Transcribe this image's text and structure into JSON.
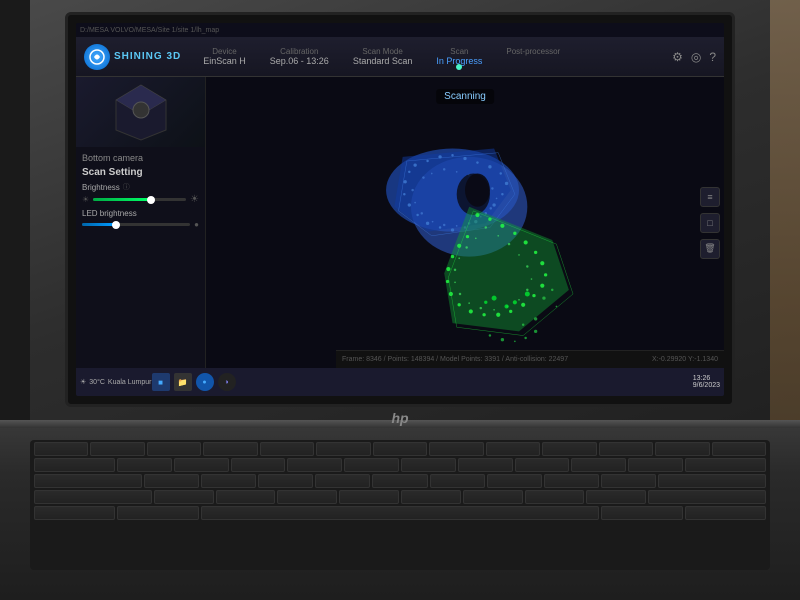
{
  "window": {
    "title": "D:/MESA VOLVO/MESA/Site 1/site 1/lh_map",
    "titlebar_path": "D:/MESA VOLVO/MESA/Site 1/site 1/lh_map"
  },
  "app": {
    "name": "SHINING 3D",
    "logo_text": "SHINING 3D"
  },
  "nav": {
    "device_label": "Device",
    "device_value": "EinScan H",
    "calibration_label": "Calibration",
    "calibration_value": "Sep.06 - 13:26",
    "scan_mode_label": "Scan Mode",
    "scan_mode_value": "Standard Scan",
    "scan_label": "Scan",
    "scan_value": "In Progress",
    "post_label": "Post-processor",
    "post_value": ""
  },
  "header_icons": [
    "⚙",
    "◎",
    "?"
  ],
  "sidebar": {
    "section_label": "Bottom camera",
    "scan_setting": "Scan Setting",
    "brightness_label": "Brightness",
    "led_brightness_label": "LED brightness"
  },
  "viewport": {
    "scanning_text": "Scanning"
  },
  "tools": [
    "≡≡",
    "□",
    "🗑"
  ],
  "status": {
    "info1": "Frame: 8346 / Points: 148394 / Model Points: 3391 / Anti-collision: 22497",
    "coords": "X:-0.29920 Y:-1.1340"
  },
  "taskbar": {
    "weather": "30°C",
    "city": "Kuala Lumpur"
  },
  "colors": {
    "accent_cyan": "#4af5c8",
    "accent_blue": "#4a9fff",
    "scan_blue": "#3388ff",
    "scan_green": "#22cc44",
    "bg_dark": "#0a0a14"
  }
}
